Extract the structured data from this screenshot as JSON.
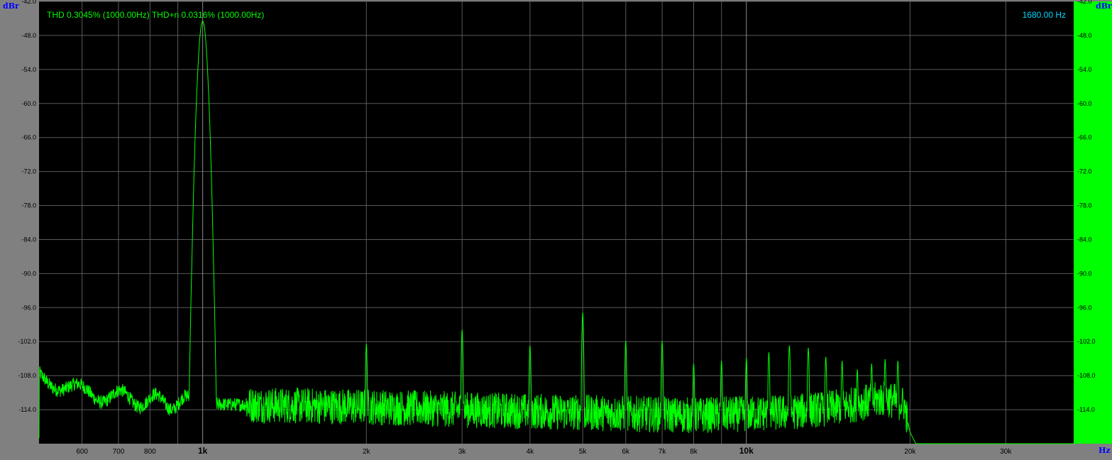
{
  "readout": {
    "thd_text": "THD 0.3045% (1000.00Hz) THD+n 0.0316% (1000.00Hz)",
    "cursor_text": "1680.00 Hz"
  },
  "colors": {
    "trace": "#00ff00",
    "plot_bg": "#000000",
    "grid": "#5a5a5a",
    "frame": "#808080",
    "right_panel": "#00ff00",
    "unit_label": "#0000ff",
    "cursor_text": "#00d8ff"
  },
  "chart_data": {
    "type": "line",
    "xscale": "log",
    "xlabel": "Hz",
    "ylabel": "dBr",
    "xlim": [
      500,
      40000
    ],
    "ylim": [
      -120,
      -42
    ],
    "grid": true,
    "y_ticks": [
      -42,
      -48,
      -54,
      -60,
      -66,
      -72,
      -78,
      -84,
      -90,
      -96,
      -102,
      -108,
      -114
    ],
    "y_tick_labels": [
      "-42.0",
      "-48.0",
      "-54.0",
      "-60.0",
      "-66.0",
      "-72.0",
      "-78.0",
      "-84.0",
      "-90.0",
      "-96.0",
      "-102.0",
      "-108.0",
      "-114.0"
    ],
    "x_ticks": [
      {
        "value": 600,
        "label": "600",
        "major": false
      },
      {
        "value": 700,
        "label": "700",
        "major": false
      },
      {
        "value": 800,
        "label": "800",
        "major": false
      },
      {
        "value": 1000,
        "label": "1k",
        "major": true
      },
      {
        "value": 2000,
        "label": "2k",
        "major": false
      },
      {
        "value": 3000,
        "label": "3k",
        "major": false
      },
      {
        "value": 4000,
        "label": "4k",
        "major": false
      },
      {
        "value": 5000,
        "label": "5k",
        "major": false
      },
      {
        "value": 6000,
        "label": "6k",
        "major": false
      },
      {
        "value": 7000,
        "label": "7k",
        "major": false
      },
      {
        "value": 8000,
        "label": "8k",
        "major": false
      },
      {
        "value": 10000,
        "label": "10k",
        "major": true
      },
      {
        "value": 20000,
        "label": "20k",
        "major": false
      },
      {
        "value": 30000,
        "label": "30k",
        "major": false
      }
    ],
    "x_minor_ticks": [
      900,
      9000
    ],
    "peaks": [
      {
        "x": 1000,
        "y": -45.5
      },
      {
        "x": 2000,
        "y": -102.5
      },
      {
        "x": 3000,
        "y": -100
      },
      {
        "x": 4000,
        "y": -102.8
      },
      {
        "x": 5000,
        "y": -97
      },
      {
        "x": 6000,
        "y": -102
      },
      {
        "x": 7000,
        "y": -102
      },
      {
        "x": 8000,
        "y": -106
      },
      {
        "x": 9000,
        "y": -105.5
      },
      {
        "x": 10000,
        "y": -105
      },
      {
        "x": 11000,
        "y": -104
      },
      {
        "x": 12000,
        "y": -102.8
      },
      {
        "x": 13000,
        "y": -103.2
      },
      {
        "x": 14000,
        "y": -104.8
      },
      {
        "x": 15000,
        "y": -105.5
      },
      {
        "x": 16000,
        "y": -107
      },
      {
        "x": 17000,
        "y": -106
      },
      {
        "x": 18000,
        "y": -105.2
      },
      {
        "x": 19000,
        "y": -105.5
      }
    ],
    "noise_floor": [
      {
        "x": 500,
        "y": -108
      },
      {
        "x": 600,
        "y": -111
      },
      {
        "x": 800,
        "y": -112.5
      },
      {
        "x": 1000,
        "y": -113
      },
      {
        "x": 2000,
        "y": -113.5
      },
      {
        "x": 3000,
        "y": -114
      },
      {
        "x": 5000,
        "y": -114.5
      },
      {
        "x": 8000,
        "y": -115
      },
      {
        "x": 12000,
        "y": -114.5
      },
      {
        "x": 15000,
        "y": -113.5
      },
      {
        "x": 18000,
        "y": -112
      },
      {
        "x": 19500,
        "y": -113
      },
      {
        "x": 20000,
        "y": -118
      },
      {
        "x": 20500,
        "y": -120
      },
      {
        "x": 40000,
        "y": -120
      }
    ]
  }
}
